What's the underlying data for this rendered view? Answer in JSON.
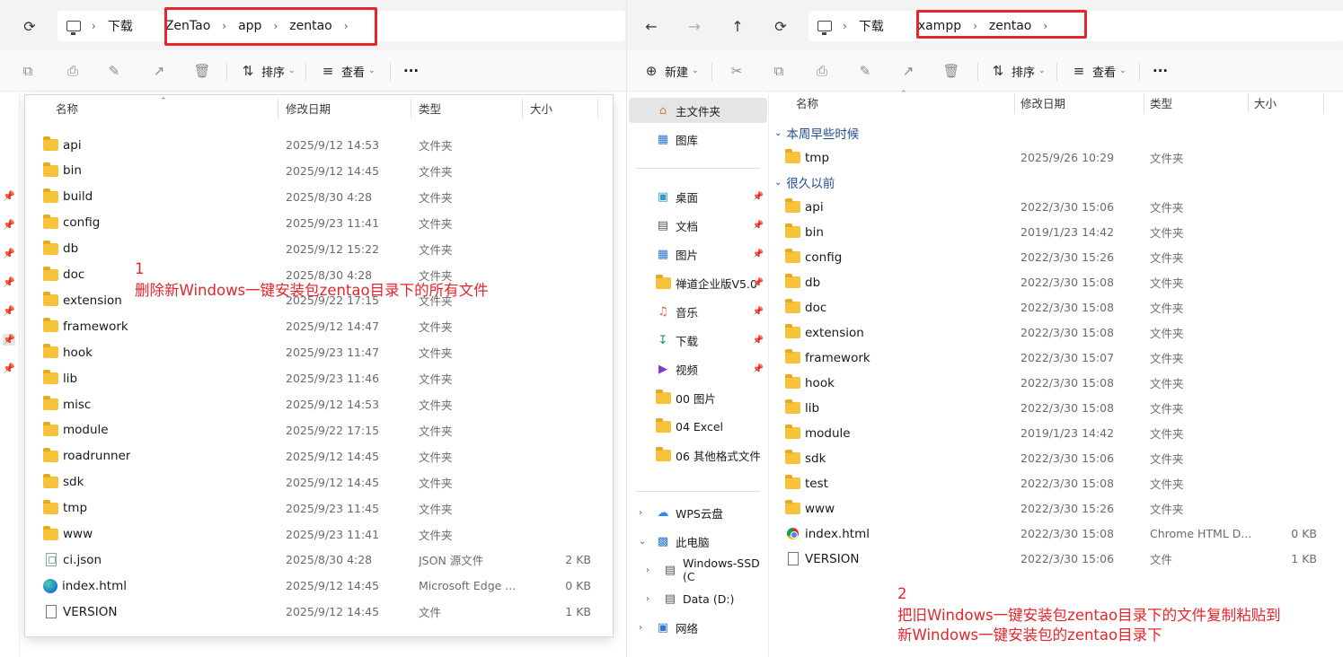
{
  "left": {
    "address": {
      "root": "下载",
      "path": [
        "ZenTao",
        "app",
        "zentao"
      ]
    },
    "toolbar": {
      "sort_label": "排序",
      "view_label": "查看",
      "more_label": "···"
    },
    "columns": {
      "name": "名称",
      "date": "修改日期",
      "type": "类型",
      "size": "大小"
    },
    "files": [
      {
        "name": "api",
        "date": "2025/9/12 14:53",
        "type": "文件夹",
        "size": "",
        "icon": "folder-icon"
      },
      {
        "name": "bin",
        "date": "2025/9/12 14:45",
        "type": "文件夹",
        "size": "",
        "icon": "folder-icon"
      },
      {
        "name": "build",
        "date": "2025/8/30 4:28",
        "type": "文件夹",
        "size": "",
        "icon": "folder-icon"
      },
      {
        "name": "config",
        "date": "2025/9/23 11:41",
        "type": "文件夹",
        "size": "",
        "icon": "folder-icon"
      },
      {
        "name": "db",
        "date": "2025/9/12 15:22",
        "type": "文件夹",
        "size": "",
        "icon": "folder-icon"
      },
      {
        "name": "doc",
        "date": "2025/8/30 4:28",
        "type": "文件夹",
        "size": "",
        "icon": "folder-icon"
      },
      {
        "name": "extension",
        "date": "2025/9/22 17:15",
        "type": "文件夹",
        "size": "",
        "icon": "folder-icon"
      },
      {
        "name": "framework",
        "date": "2025/9/12 14:47",
        "type": "文件夹",
        "size": "",
        "icon": "folder-icon"
      },
      {
        "name": "hook",
        "date": "2025/9/23 11:47",
        "type": "文件夹",
        "size": "",
        "icon": "folder-icon"
      },
      {
        "name": "lib",
        "date": "2025/9/23 11:46",
        "type": "文件夹",
        "size": "",
        "icon": "folder-icon"
      },
      {
        "name": "misc",
        "date": "2025/9/12 14:53",
        "type": "文件夹",
        "size": "",
        "icon": "folder-icon"
      },
      {
        "name": "module",
        "date": "2025/9/22 17:15",
        "type": "文件夹",
        "size": "",
        "icon": "folder-icon"
      },
      {
        "name": "roadrunner",
        "date": "2025/9/12 14:45",
        "type": "文件夹",
        "size": "",
        "icon": "folder-icon"
      },
      {
        "name": "sdk",
        "date": "2025/9/12 14:45",
        "type": "文件夹",
        "size": "",
        "icon": "folder-icon"
      },
      {
        "name": "tmp",
        "date": "2025/9/23 11:45",
        "type": "文件夹",
        "size": "",
        "icon": "folder-icon"
      },
      {
        "name": "www",
        "date": "2025/9/23 11:41",
        "type": "文件夹",
        "size": "",
        "icon": "folder-icon"
      },
      {
        "name": "ci.json",
        "date": "2025/8/30 4:28",
        "type": "JSON 源文件",
        "size": "2 KB",
        "icon": "json-file-icon"
      },
      {
        "name": "index.html",
        "date": "2025/9/12 14:45",
        "type": "Microsoft Edge ...",
        "size": "0 KB",
        "icon": "edge-icon"
      },
      {
        "name": "VERSION",
        "date": "2025/9/12 14:45",
        "type": "文件",
        "size": "1 KB",
        "icon": "file-icon"
      }
    ],
    "annotation": {
      "number": "1",
      "text": "删除新Windows一键安装包zentao目录下的所有文件"
    }
  },
  "right": {
    "address": {
      "root": "下载",
      "path": [
        "xampp",
        "zentao"
      ]
    },
    "toolbar": {
      "new_label": "新建",
      "sort_label": "排序",
      "view_label": "查看",
      "more_label": "···"
    },
    "columns": {
      "name": "名称",
      "date": "修改日期",
      "type": "类型",
      "size": "大小"
    },
    "nav": {
      "home": "主文件夹",
      "gallery": "图库",
      "pinned": [
        "桌面",
        "文档",
        "图片",
        "禅道企业版V5.0",
        "音乐",
        "下载",
        "视频"
      ],
      "folders": [
        "00 图片",
        "04 Excel",
        "06 其他格式文件"
      ],
      "wps": "WPS云盘",
      "pc": "此电脑",
      "drives": [
        "Windows-SSD (C",
        "Data (D:)"
      ],
      "network": "网络"
    },
    "groups": {
      "recent": "本周早些时候",
      "old": "很久以前"
    },
    "recent_files": [
      {
        "name": "tmp",
        "date": "2025/9/26 10:29",
        "type": "文件夹",
        "size": ""
      }
    ],
    "files": [
      {
        "name": "api",
        "date": "2022/3/30 15:06",
        "type": "文件夹",
        "size": "",
        "icon": "folder-icon"
      },
      {
        "name": "bin",
        "date": "2019/1/23 14:42",
        "type": "文件夹",
        "size": "",
        "icon": "folder-icon"
      },
      {
        "name": "config",
        "date": "2022/3/30 15:26",
        "type": "文件夹",
        "size": "",
        "icon": "folder-icon"
      },
      {
        "name": "db",
        "date": "2022/3/30 15:08",
        "type": "文件夹",
        "size": "",
        "icon": "folder-icon"
      },
      {
        "name": "doc",
        "date": "2022/3/30 15:08",
        "type": "文件夹",
        "size": "",
        "icon": "folder-icon"
      },
      {
        "name": "extension",
        "date": "2022/3/30 15:08",
        "type": "文件夹",
        "size": "",
        "icon": "folder-icon"
      },
      {
        "name": "framework",
        "date": "2022/3/30 15:07",
        "type": "文件夹",
        "size": "",
        "icon": "folder-icon"
      },
      {
        "name": "hook",
        "date": "2022/3/30 15:08",
        "type": "文件夹",
        "size": "",
        "icon": "folder-icon"
      },
      {
        "name": "lib",
        "date": "2022/3/30 15:08",
        "type": "文件夹",
        "size": "",
        "icon": "folder-icon"
      },
      {
        "name": "module",
        "date": "2019/1/23 14:42",
        "type": "文件夹",
        "size": "",
        "icon": "folder-icon"
      },
      {
        "name": "sdk",
        "date": "2022/3/30 15:06",
        "type": "文件夹",
        "size": "",
        "icon": "folder-icon"
      },
      {
        "name": "test",
        "date": "2022/3/30 15:08",
        "type": "文件夹",
        "size": "",
        "icon": "folder-icon"
      },
      {
        "name": "www",
        "date": "2022/3/30 15:26",
        "type": "文件夹",
        "size": "",
        "icon": "folder-icon"
      },
      {
        "name": "index.html",
        "date": "2022/3/30 15:08",
        "type": "Chrome HTML D...",
        "size": "0 KB",
        "icon": "chrome-icon"
      },
      {
        "name": "VERSION",
        "date": "2022/3/30 15:06",
        "type": "文件",
        "size": "1 KB",
        "icon": "file-icon"
      }
    ],
    "annotation": {
      "number": "2",
      "line1": "把旧Windows一键安装包zentao目录下的文件复制粘贴到",
      "line2": "新Windows一键安装包的zentao目录下"
    }
  },
  "colors": {
    "highlight": "#e8242c",
    "annotation": "#e8242c",
    "folder": "#f7c33b",
    "group_header": "#1f4e8c"
  }
}
